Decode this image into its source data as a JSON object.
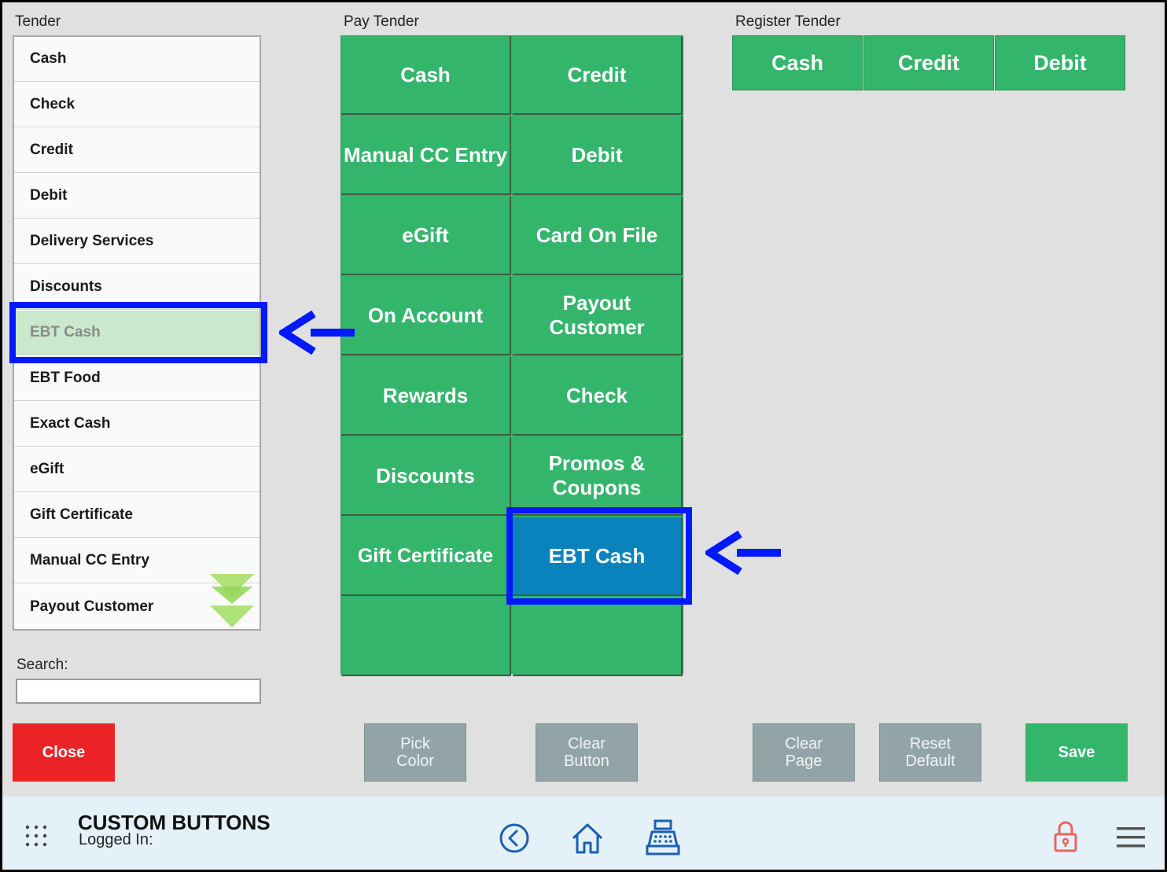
{
  "sections": {
    "tender": "Tender",
    "pay_tender": "Pay Tender",
    "register_tender": "Register Tender"
  },
  "tender_list": {
    "items": [
      "Cash",
      "Check",
      "Credit",
      "Debit",
      "Delivery Services",
      "Discounts",
      "EBT Cash",
      "EBT Food",
      "Exact Cash",
      "eGift",
      "Gift Certificate",
      "Manual CC Entry",
      "Payout Customer"
    ],
    "selected": "EBT Cash"
  },
  "pay_tender": {
    "buttons": [
      "Cash",
      "Credit",
      "Manual CC Entry",
      "Debit",
      "eGift",
      "Card On File",
      "On Account",
      "Payout Customer",
      "Rewards",
      "Check",
      "Discounts",
      "Promos & Coupons",
      "Gift Certificate",
      "EBT Cash",
      "",
      ""
    ],
    "highlighted": "EBT Cash"
  },
  "register_tender": {
    "buttons": [
      "Cash",
      "Credit",
      "Debit"
    ]
  },
  "search": {
    "label": "Search:",
    "value": ""
  },
  "actions": {
    "close": "Close",
    "pick_color": "Pick Color",
    "clear_button": "Clear Button",
    "clear_page": "Clear Page",
    "reset_default": "Reset Default",
    "save": "Save"
  },
  "footer": {
    "title": "CUSTOM BUTTONS",
    "logged_in": "Logged In:"
  },
  "colors": {
    "green": "#34b56c",
    "highlight_blue": "#0a82bd",
    "annotation_blue": "#0019ff",
    "close_red": "#ec2326",
    "gray_button": "#93a4a8",
    "selected_item": "#c9e8cd"
  }
}
